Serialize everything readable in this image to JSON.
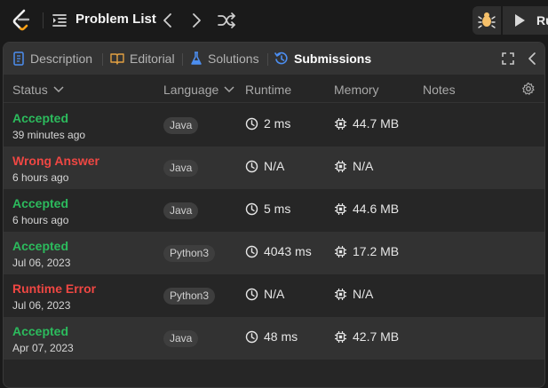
{
  "nav": {
    "problem_list_label": "Problem List",
    "run_label": "Ru"
  },
  "tabs": [
    {
      "label": "Description"
    },
    {
      "label": "Editorial"
    },
    {
      "label": "Solutions"
    },
    {
      "label": "Submissions"
    }
  ],
  "columns": {
    "status": "Status",
    "language": "Language",
    "runtime": "Runtime",
    "memory": "Memory",
    "notes": "Notes"
  },
  "colors": {
    "accepted": "#2cbb5d",
    "error": "#ef4743"
  },
  "submissions": [
    {
      "status": "Accepted",
      "when": "39 minutes ago",
      "language": "Java",
      "runtime": "2 ms",
      "memory": "44.7 MB"
    },
    {
      "status": "Wrong Answer",
      "when": "6 hours ago",
      "language": "Java",
      "runtime": "N/A",
      "memory": "N/A"
    },
    {
      "status": "Accepted",
      "when": "6 hours ago",
      "language": "Java",
      "runtime": "5 ms",
      "memory": "44.6 MB"
    },
    {
      "status": "Accepted",
      "when": "Jul 06, 2023",
      "language": "Python3",
      "runtime": "4043 ms",
      "memory": "17.2 MB"
    },
    {
      "status": "Runtime Error",
      "when": "Jul 06, 2023",
      "language": "Python3",
      "runtime": "N/A",
      "memory": "N/A"
    },
    {
      "status": "Accepted",
      "when": "Apr 07, 2023",
      "language": "Java",
      "runtime": "48 ms",
      "memory": "42.7 MB"
    }
  ]
}
